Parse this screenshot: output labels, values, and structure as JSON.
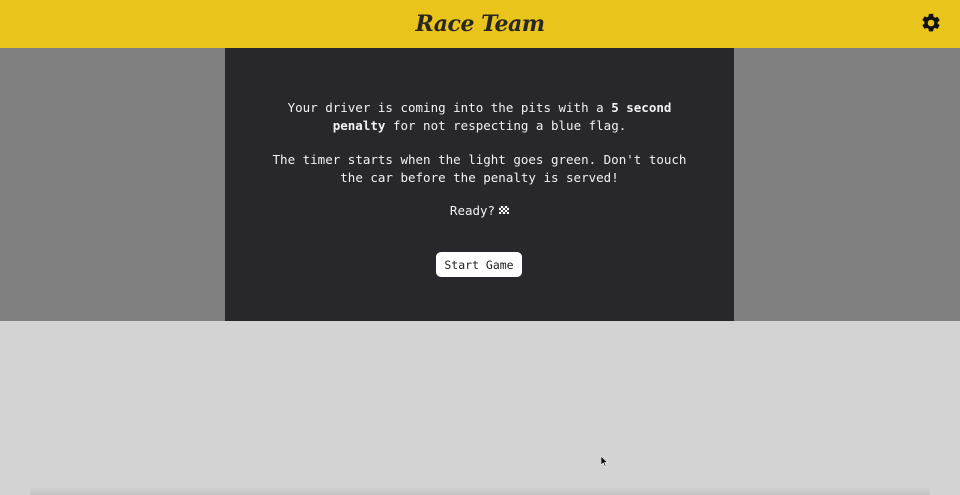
{
  "header": {
    "title": "Race Team",
    "background_color": "#e9c41a",
    "settings_icon": "gear-icon"
  },
  "game": {
    "intro_text_before": "Your driver is coming into the pits with a ",
    "penalty_text": "5 second penalty",
    "intro_text_after": " for not respecting a blue flag.",
    "instructions": "The timer starts when the light goes green. Don't touch the car before the penalty is served!",
    "ready_text": "Ready?",
    "ready_icon": "chequered-flag-icon",
    "start_button_label": "Start Game",
    "panel_color": "#28272b"
  }
}
